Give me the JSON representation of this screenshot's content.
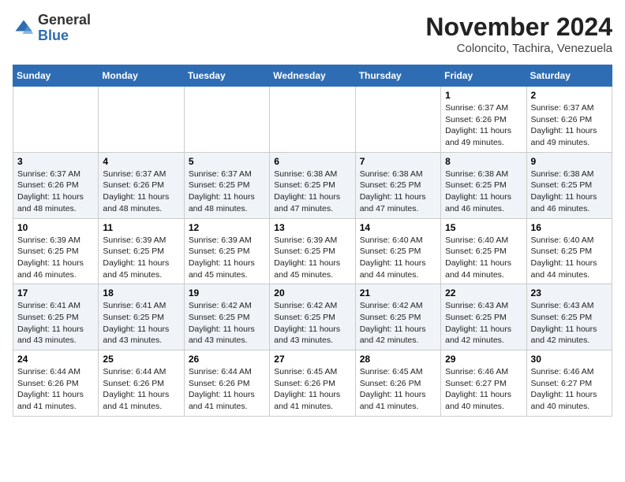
{
  "logo": {
    "general": "General",
    "blue": "Blue"
  },
  "header": {
    "month": "November 2024",
    "location": "Coloncito, Tachira, Venezuela"
  },
  "weekdays": [
    "Sunday",
    "Monday",
    "Tuesday",
    "Wednesday",
    "Thursday",
    "Friday",
    "Saturday"
  ],
  "weeks": [
    [
      {
        "day": "",
        "info": ""
      },
      {
        "day": "",
        "info": ""
      },
      {
        "day": "",
        "info": ""
      },
      {
        "day": "",
        "info": ""
      },
      {
        "day": "",
        "info": ""
      },
      {
        "day": "1",
        "info": "Sunrise: 6:37 AM\nSunset: 6:26 PM\nDaylight: 11 hours and 49 minutes."
      },
      {
        "day": "2",
        "info": "Sunrise: 6:37 AM\nSunset: 6:26 PM\nDaylight: 11 hours and 49 minutes."
      }
    ],
    [
      {
        "day": "3",
        "info": "Sunrise: 6:37 AM\nSunset: 6:26 PM\nDaylight: 11 hours and 48 minutes."
      },
      {
        "day": "4",
        "info": "Sunrise: 6:37 AM\nSunset: 6:26 PM\nDaylight: 11 hours and 48 minutes."
      },
      {
        "day": "5",
        "info": "Sunrise: 6:37 AM\nSunset: 6:25 PM\nDaylight: 11 hours and 48 minutes."
      },
      {
        "day": "6",
        "info": "Sunrise: 6:38 AM\nSunset: 6:25 PM\nDaylight: 11 hours and 47 minutes."
      },
      {
        "day": "7",
        "info": "Sunrise: 6:38 AM\nSunset: 6:25 PM\nDaylight: 11 hours and 47 minutes."
      },
      {
        "day": "8",
        "info": "Sunrise: 6:38 AM\nSunset: 6:25 PM\nDaylight: 11 hours and 46 minutes."
      },
      {
        "day": "9",
        "info": "Sunrise: 6:38 AM\nSunset: 6:25 PM\nDaylight: 11 hours and 46 minutes."
      }
    ],
    [
      {
        "day": "10",
        "info": "Sunrise: 6:39 AM\nSunset: 6:25 PM\nDaylight: 11 hours and 46 minutes."
      },
      {
        "day": "11",
        "info": "Sunrise: 6:39 AM\nSunset: 6:25 PM\nDaylight: 11 hours and 45 minutes."
      },
      {
        "day": "12",
        "info": "Sunrise: 6:39 AM\nSunset: 6:25 PM\nDaylight: 11 hours and 45 minutes."
      },
      {
        "day": "13",
        "info": "Sunrise: 6:39 AM\nSunset: 6:25 PM\nDaylight: 11 hours and 45 minutes."
      },
      {
        "day": "14",
        "info": "Sunrise: 6:40 AM\nSunset: 6:25 PM\nDaylight: 11 hours and 44 minutes."
      },
      {
        "day": "15",
        "info": "Sunrise: 6:40 AM\nSunset: 6:25 PM\nDaylight: 11 hours and 44 minutes."
      },
      {
        "day": "16",
        "info": "Sunrise: 6:40 AM\nSunset: 6:25 PM\nDaylight: 11 hours and 44 minutes."
      }
    ],
    [
      {
        "day": "17",
        "info": "Sunrise: 6:41 AM\nSunset: 6:25 PM\nDaylight: 11 hours and 43 minutes."
      },
      {
        "day": "18",
        "info": "Sunrise: 6:41 AM\nSunset: 6:25 PM\nDaylight: 11 hours and 43 minutes."
      },
      {
        "day": "19",
        "info": "Sunrise: 6:42 AM\nSunset: 6:25 PM\nDaylight: 11 hours and 43 minutes."
      },
      {
        "day": "20",
        "info": "Sunrise: 6:42 AM\nSunset: 6:25 PM\nDaylight: 11 hours and 43 minutes."
      },
      {
        "day": "21",
        "info": "Sunrise: 6:42 AM\nSunset: 6:25 PM\nDaylight: 11 hours and 42 minutes."
      },
      {
        "day": "22",
        "info": "Sunrise: 6:43 AM\nSunset: 6:25 PM\nDaylight: 11 hours and 42 minutes."
      },
      {
        "day": "23",
        "info": "Sunrise: 6:43 AM\nSunset: 6:25 PM\nDaylight: 11 hours and 42 minutes."
      }
    ],
    [
      {
        "day": "24",
        "info": "Sunrise: 6:44 AM\nSunset: 6:26 PM\nDaylight: 11 hours and 41 minutes."
      },
      {
        "day": "25",
        "info": "Sunrise: 6:44 AM\nSunset: 6:26 PM\nDaylight: 11 hours and 41 minutes."
      },
      {
        "day": "26",
        "info": "Sunrise: 6:44 AM\nSunset: 6:26 PM\nDaylight: 11 hours and 41 minutes."
      },
      {
        "day": "27",
        "info": "Sunrise: 6:45 AM\nSunset: 6:26 PM\nDaylight: 11 hours and 41 minutes."
      },
      {
        "day": "28",
        "info": "Sunrise: 6:45 AM\nSunset: 6:26 PM\nDaylight: 11 hours and 41 minutes."
      },
      {
        "day": "29",
        "info": "Sunrise: 6:46 AM\nSunset: 6:27 PM\nDaylight: 11 hours and 40 minutes."
      },
      {
        "day": "30",
        "info": "Sunrise: 6:46 AM\nSunset: 6:27 PM\nDaylight: 11 hours and 40 minutes."
      }
    ]
  ]
}
